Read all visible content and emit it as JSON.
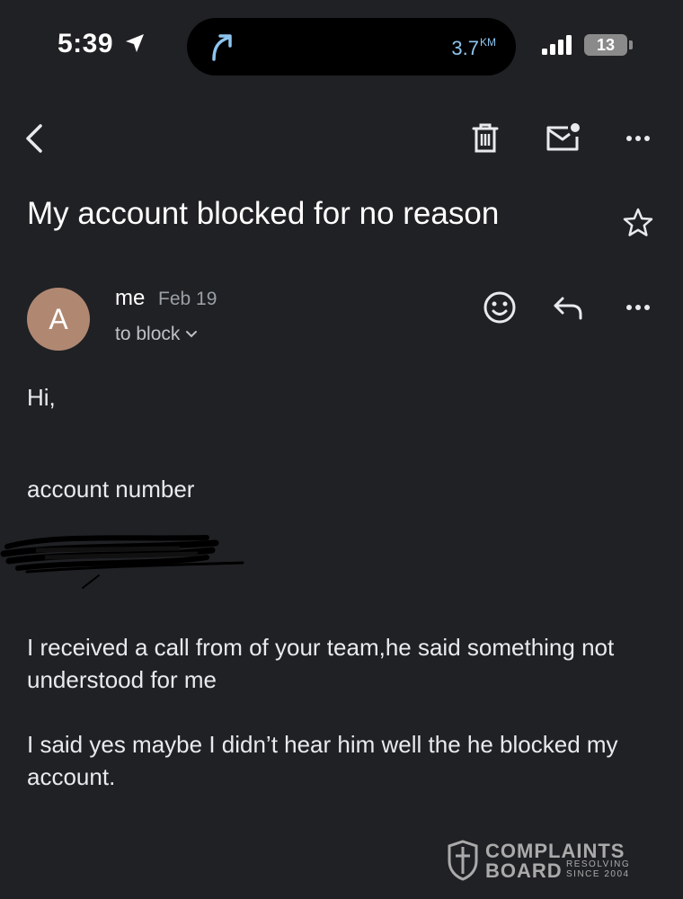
{
  "status_bar": {
    "time": "5:39",
    "distance": "3.7",
    "distance_unit": "KM",
    "battery": "13",
    "icons": [
      "location-arrow-icon",
      "navigation-arrow-icon",
      "signal-icon",
      "battery-icon"
    ]
  },
  "toolbar": {
    "icons": [
      "back-icon",
      "trash-icon",
      "mark-unread-icon",
      "more-icon"
    ]
  },
  "email": {
    "subject": "My account blocked for no reason",
    "sender": {
      "avatar_letter": "A",
      "avatar_color": "#b08872",
      "name": "me",
      "date": "Feb 19",
      "recipient": "to block"
    },
    "body": {
      "greeting": "Hi,",
      "account_label": "account number",
      "paragraph1": "I received a call from of your team,he said something not understood for me",
      "paragraph2": "I said yes maybe I didn’t hear him well the he blocked my account."
    }
  },
  "watermark": {
    "line1": "COMPLAINTS",
    "line2": "BOARD",
    "tag1": "RESOLVING",
    "tag2": "SINCE 2004"
  },
  "colors": {
    "background": "#202124",
    "nav_accent": "#8ec5ee"
  }
}
